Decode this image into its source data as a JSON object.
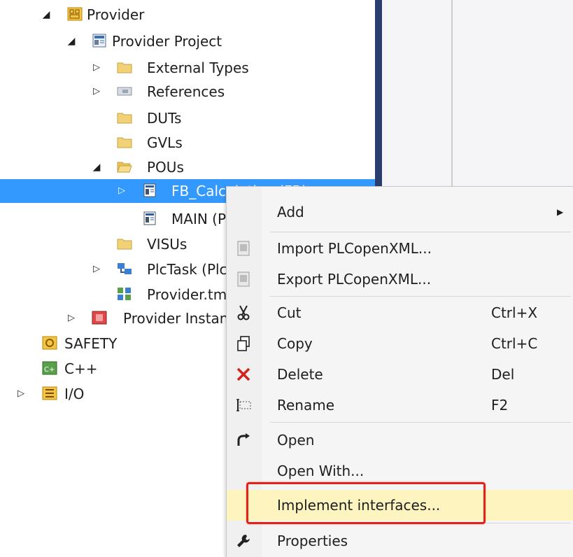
{
  "tree": {
    "items": [
      {
        "label": "Provider",
        "icon": "provider-project-icon"
      },
      {
        "label": "Provider Project",
        "icon": "plc-project-icon"
      },
      {
        "label": "External Types",
        "icon": "folder-icon"
      },
      {
        "label": "References",
        "icon": "references-icon"
      },
      {
        "label": "DUTs",
        "icon": "folder-icon"
      },
      {
        "label": "GVLs",
        "icon": "folder-icon"
      },
      {
        "label": "POUs",
        "icon": "folder-open-icon"
      },
      {
        "label": "FB_Calculation (FB)",
        "icon": "function-block-icon"
      },
      {
        "label": "MAIN (PRG)",
        "icon": "program-icon"
      },
      {
        "label": "VISUs",
        "icon": "folder-icon"
      },
      {
        "label": "PlcTask (PlcTask)",
        "icon": "task-icon"
      },
      {
        "label": "Provider.tmc",
        "icon": "tmc-file-icon"
      },
      {
        "label": "Provider Instance",
        "icon": "instance-icon"
      },
      {
        "label": "SAFETY",
        "icon": "safety-icon"
      },
      {
        "label": "C++",
        "icon": "cpp-icon"
      },
      {
        "label": "I/O",
        "icon": "io-icon"
      }
    ],
    "selected_index": 7
  },
  "context_menu": {
    "items": [
      {
        "label": "Add",
        "shortcut": "",
        "icon": "",
        "submenu": true
      },
      {
        "label": "Import PLCopenXML...",
        "shortcut": "",
        "icon": "import-xml-icon"
      },
      {
        "label": "Export PLCopenXML...",
        "shortcut": "",
        "icon": "export-xml-icon"
      },
      {
        "label": "Cut",
        "shortcut": "Ctrl+X",
        "icon": "scissors-icon"
      },
      {
        "label": "Copy",
        "shortcut": "Ctrl+C",
        "icon": "copy-icon"
      },
      {
        "label": "Delete",
        "shortcut": "Del",
        "icon": "delete-icon"
      },
      {
        "label": "Rename",
        "shortcut": "F2",
        "icon": "rename-icon"
      },
      {
        "label": "Open",
        "shortcut": "",
        "icon": "open-icon"
      },
      {
        "label": "Open With...",
        "shortcut": "",
        "icon": ""
      },
      {
        "label": "Implement interfaces...",
        "shortcut": "",
        "icon": ""
      },
      {
        "label": "Properties",
        "shortcut": "",
        "icon": "wrench-icon"
      }
    ],
    "highlighted_label": "Implement interfaces...",
    "submenu_arrow": "▶"
  },
  "colors": {
    "selection": "#3399ff",
    "menu_background": "#f5f5f5",
    "menu_highlight": "#fdf4bf",
    "callout_box": "#e2231a",
    "divider": "#2a3e6e"
  }
}
